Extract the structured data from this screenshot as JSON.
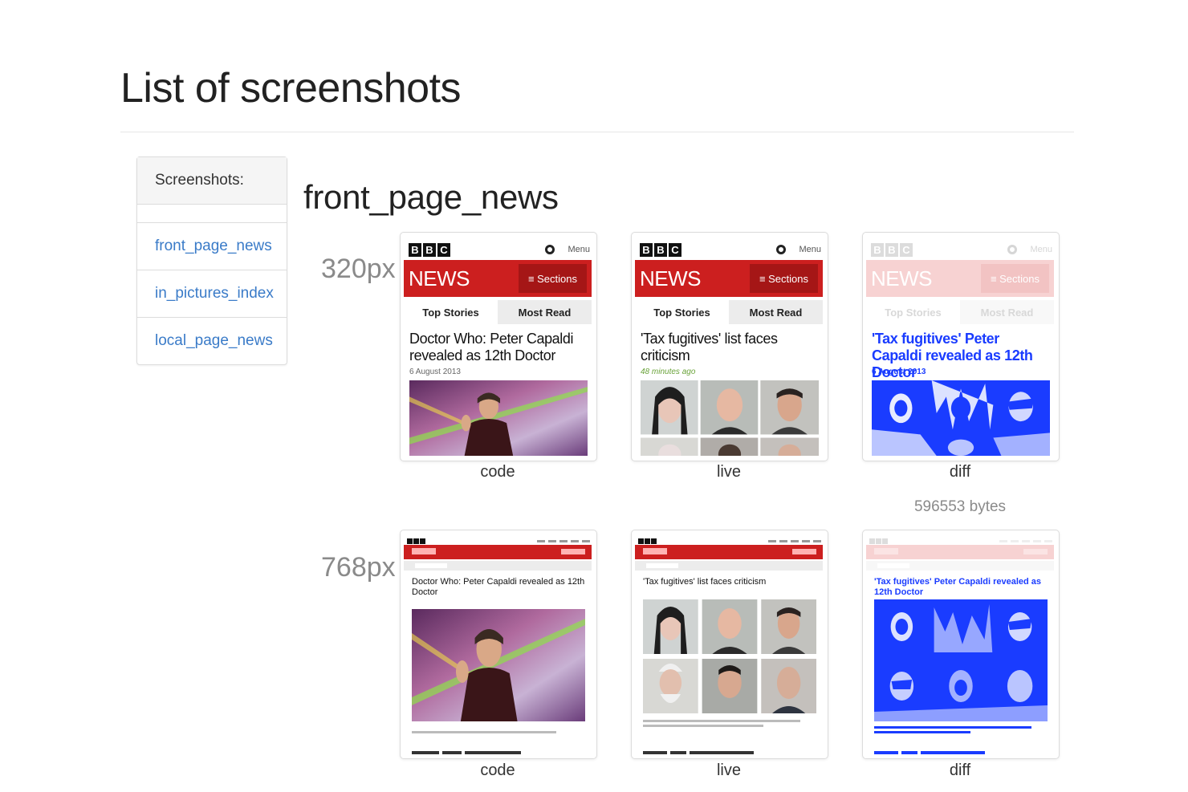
{
  "page": {
    "title": "List of screenshots"
  },
  "sidebar": {
    "header": "Screenshots:",
    "items": [
      {
        "label": "front_page_news"
      },
      {
        "label": "in_pictures_index"
      },
      {
        "label": "local_page_news"
      }
    ]
  },
  "section": {
    "title": "front_page_news",
    "rows": [
      {
        "width_label": "320px",
        "captions": [
          "code",
          "live",
          "diff"
        ],
        "diff_size": "596553 bytes",
        "mock": {
          "logo_letters": [
            "B",
            "B",
            "C"
          ],
          "menu": "Menu",
          "news": "NEWS",
          "sections": "≡ Sections",
          "tab_top": "Top Stories",
          "tab_most": "Most Read",
          "code_headline": "Doctor Who: Peter Capaldi revealed as 12th Doctor",
          "code_date": "6 August 2013",
          "live_headline": "'Tax fugitives' list faces criticism",
          "live_date": "48 minutes ago",
          "diff_headline": "'Tax fugitives' Peter Capaldi revealed as 12th Doctor",
          "diff_date": "6 August 2013"
        }
      },
      {
        "width_label": "768px",
        "captions": [
          "code",
          "live",
          "diff"
        ],
        "mock": {
          "code_headline": "Doctor Who: Peter Capaldi revealed as 12th Doctor",
          "live_headline": "'Tax fugitives' list faces criticism",
          "diff_headline": "'Tax fugitives' Peter Capaldi revealed as 12th Doctor"
        }
      }
    ]
  },
  "colors": {
    "bbc_red": "#cc1f1f",
    "link_blue": "#3a7bc8",
    "diff_blue": "#1a3cff"
  }
}
